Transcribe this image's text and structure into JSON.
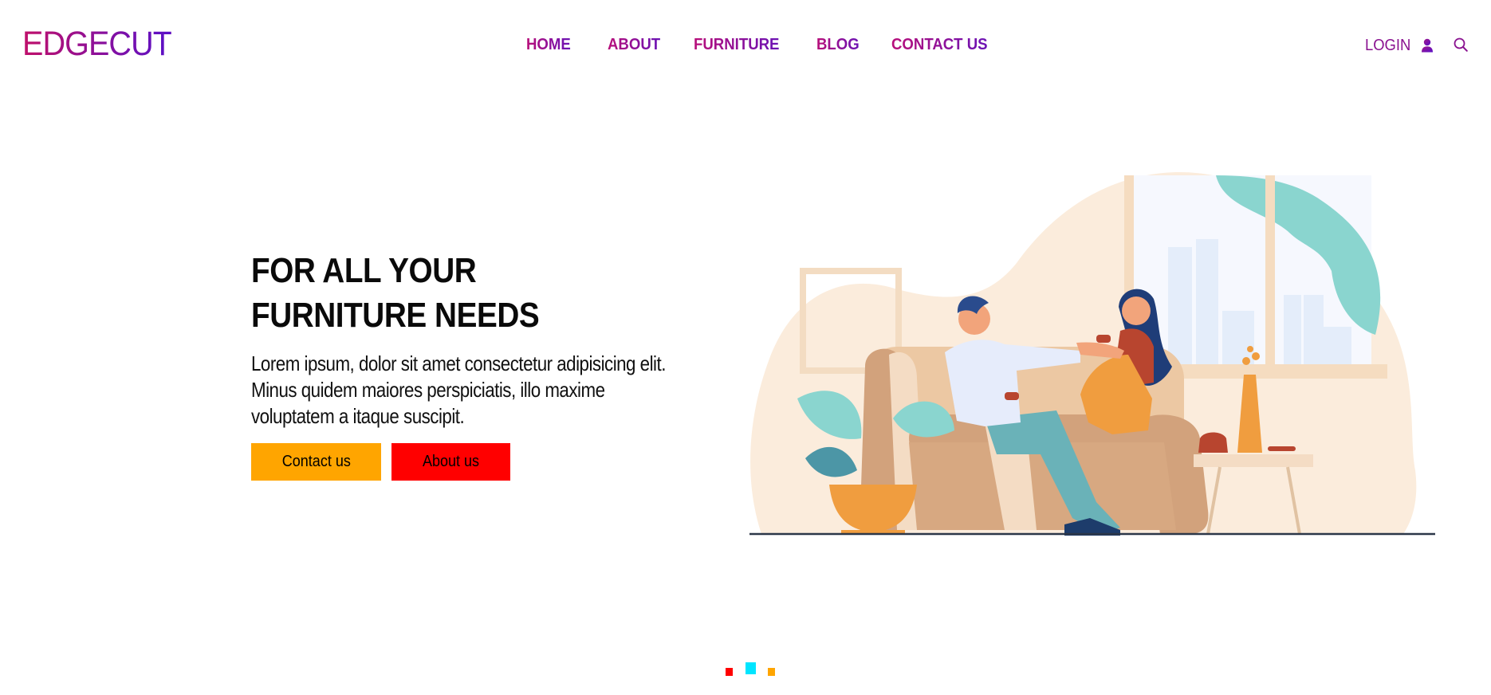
{
  "brand": {
    "logo_text": "EDGECUT",
    "gradient_colors": [
      "#c0106a",
      "#5a10c8"
    ]
  },
  "nav": {
    "items": [
      {
        "label": "HOME"
      },
      {
        "label": "ABOUT"
      },
      {
        "label": "FURNITURE"
      },
      {
        "label": "BLOG"
      },
      {
        "label": "CONTACT US"
      }
    ]
  },
  "header_actions": {
    "login_label": "LOGIN",
    "login_icon": "user-icon",
    "search_icon": "search-icon"
  },
  "hero": {
    "title": "FOR ALL YOUR FURNITURE NEEDS",
    "description": "Lorem ipsum, dolor sit amet consectetur adipisicing elit. Minus quidem maiores perspiciatis, illo maxime voluptatem a itaque suscipit.",
    "buttons": {
      "contact_label": "Contact us",
      "about_label": "About us"
    },
    "button_colors": {
      "contact": "#ffa500",
      "about": "#ff0000"
    },
    "illustration": "couple-on-sofa-illustration"
  },
  "carousel": {
    "slide_count": 3,
    "active_index": 1,
    "indicator_colors": [
      "#ff0000",
      "#00e5ff",
      "#ffa500"
    ]
  }
}
